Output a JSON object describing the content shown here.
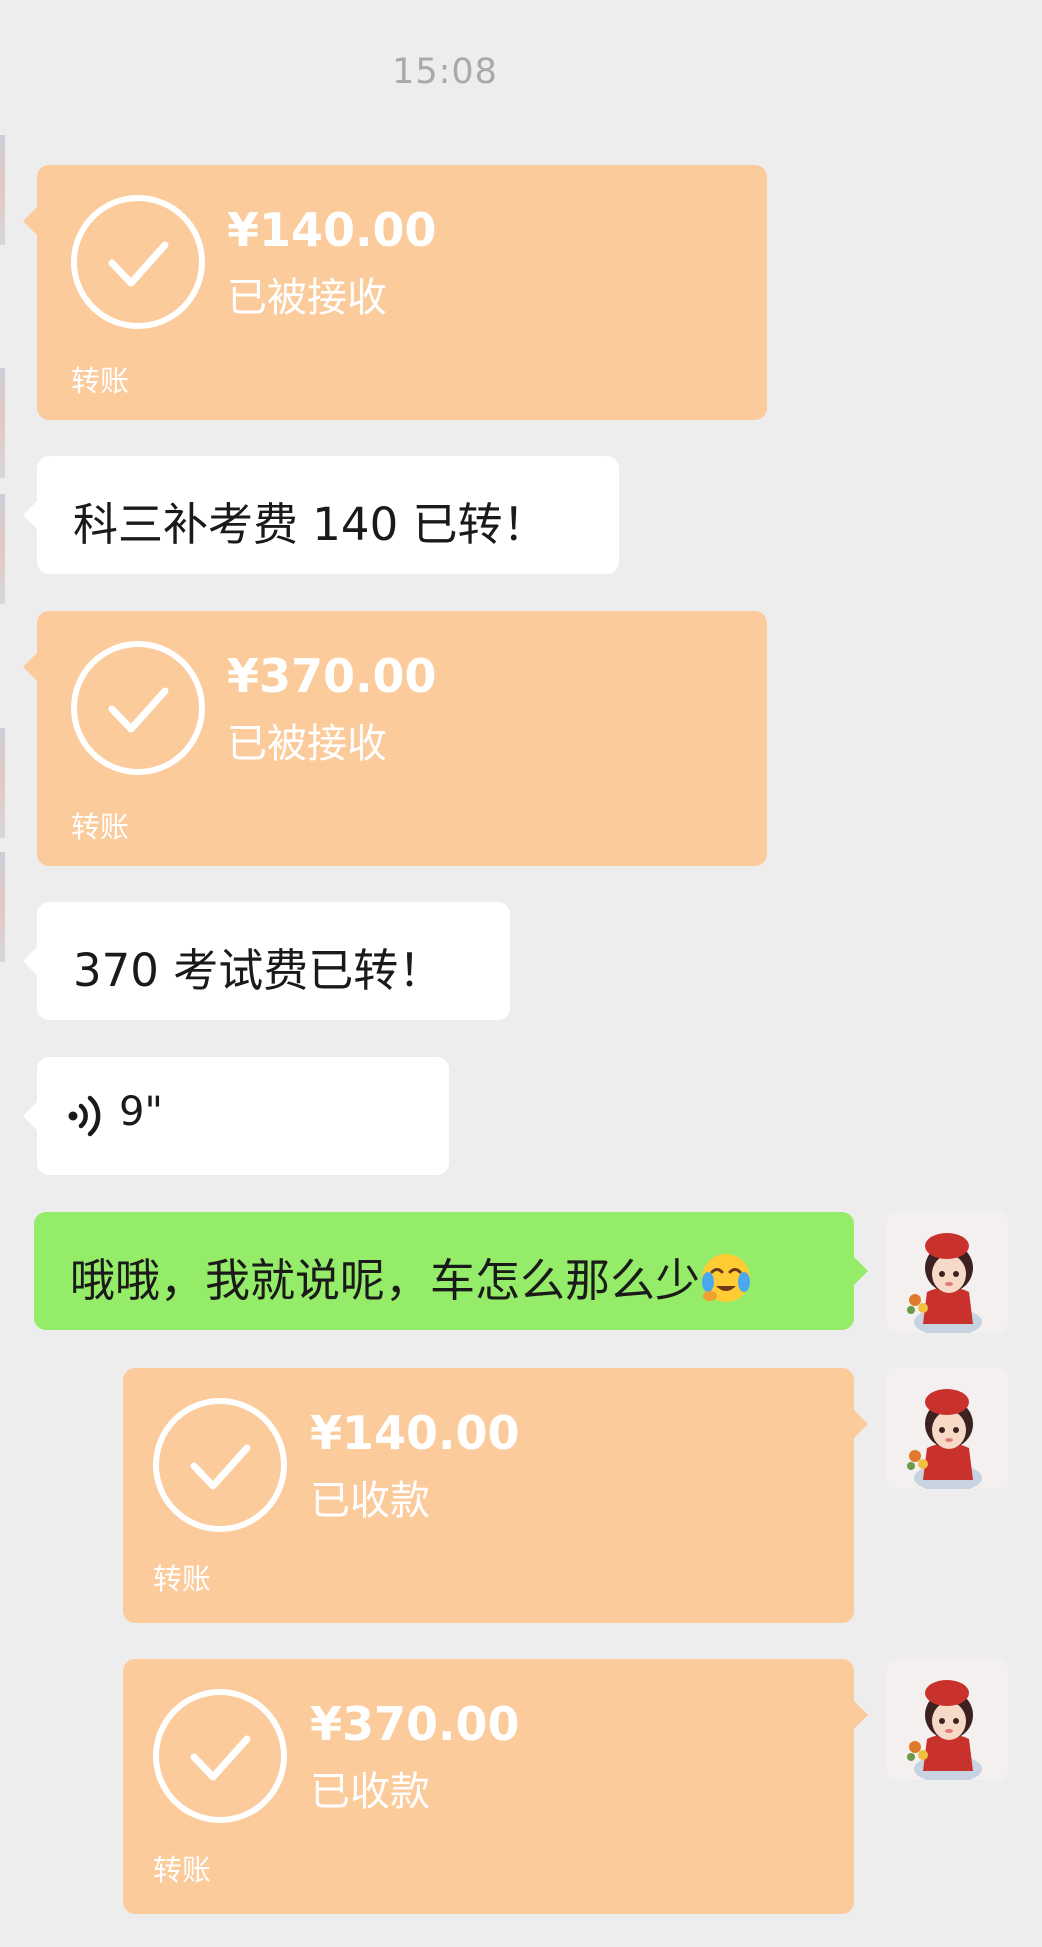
{
  "timestamp": "15:08",
  "messages": {
    "m1": {
      "amount": "¥140.00",
      "status": "已被接收",
      "label": "转账"
    },
    "m2": {
      "text": "科三补考费 140 已转！"
    },
    "m3": {
      "amount": "¥370.00",
      "status": "已被接收",
      "label": "转账"
    },
    "m4": {
      "text": "370 考试费已转！"
    },
    "m5": {
      "duration": "9\"",
      "icon": "voice-icon"
    },
    "m6": {
      "text": "哦哦，我就说呢，车怎么那么少",
      "emoji": "crying-face-emoji"
    },
    "m7": {
      "amount": "¥140.00",
      "status": "已收款",
      "label": "转账"
    },
    "m8": {
      "amount": "¥370.00",
      "status": "已收款",
      "label": "转账"
    }
  },
  "colors": {
    "background": "#ededed",
    "transfer_card": "#fbcb9c",
    "sent_bubble": "#95ec69",
    "received_bubble": "#ffffff",
    "timestamp_text": "#a9a9a9"
  }
}
